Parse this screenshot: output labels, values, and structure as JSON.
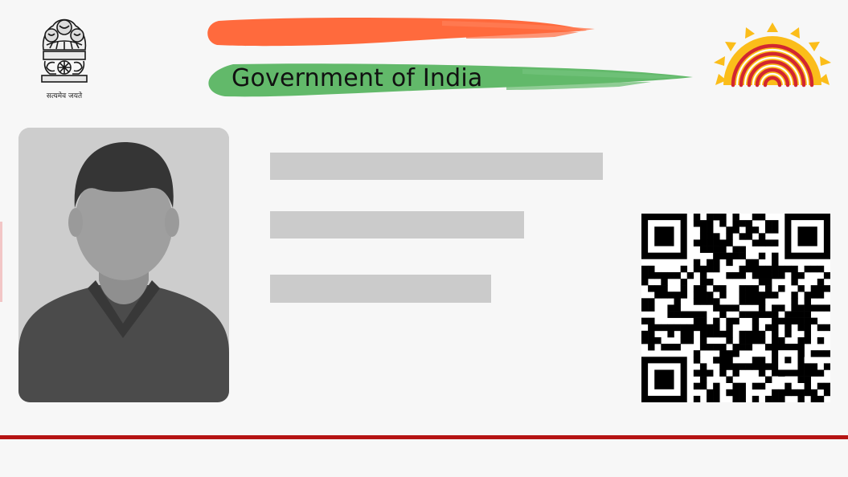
{
  "card": {
    "title": "Government of India",
    "motto": "सत्यमेव जयते",
    "emblem_icon": "ashoka-emblem-icon",
    "logo_icon": "aadhaar-sun-fingerprint-icon",
    "photo_icon": "person-placeholder-icon",
    "qr_icon": "qr-code-icon"
  },
  "colors": {
    "saffron": "#ff6a3d",
    "green": "#62b96a",
    "sun_yellow": "#fbbd1a",
    "fingerprint_red": "#d22630",
    "bottom_line": "#b51414",
    "placeholder_gray": "#cbcbcb"
  }
}
